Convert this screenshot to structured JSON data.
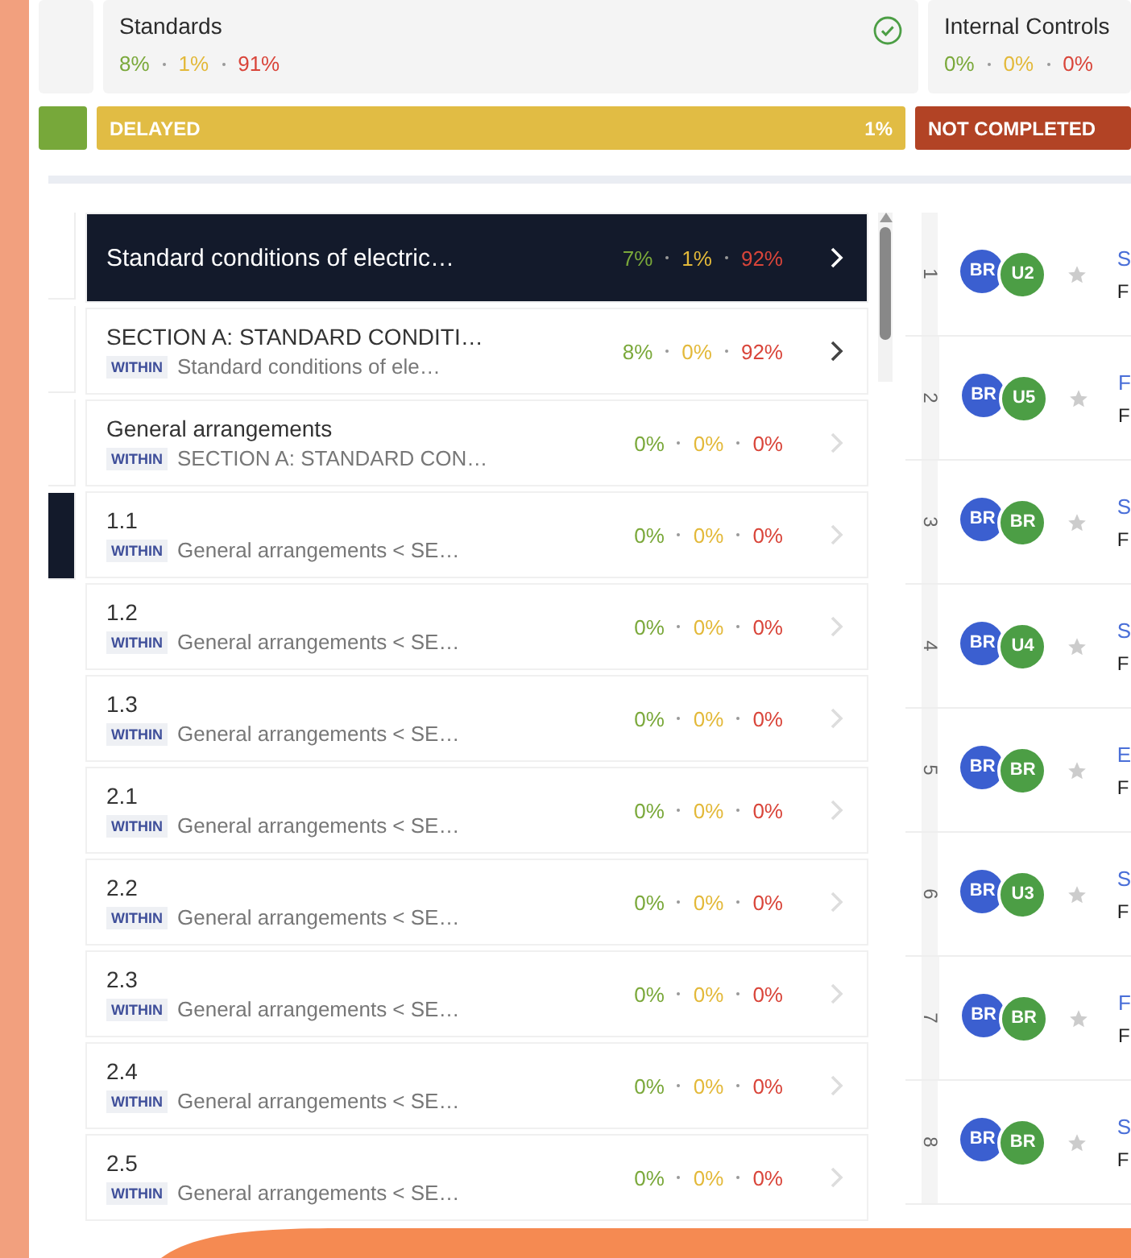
{
  "summary_cards": [
    {
      "title": "Standards",
      "checked": true,
      "stats": [
        "8%",
        "1%",
        "91%"
      ]
    },
    {
      "title": "Internal Controls",
      "checked": false,
      "stats": [
        "0%",
        "0%",
        "0%"
      ]
    }
  ],
  "status_bars": [
    {
      "kind": "completed"
    },
    {
      "kind": "delayed",
      "label": "DELAYED",
      "value": "1%"
    },
    {
      "kind": "not_completed",
      "label": "NOT COMPLETED"
    }
  ],
  "side_strip": [
    {
      "selected": false
    },
    {
      "selected": false
    },
    {
      "selected": false
    },
    {
      "selected": true
    }
  ],
  "items": [
    {
      "title": "Standard conditions of electric…",
      "selected": true,
      "has_children": true,
      "stats": [
        "7%",
        "1%",
        "92%"
      ]
    },
    {
      "title": "SECTION A: STANDARD CONDITI…",
      "within_label": "WITHIN",
      "within": "Standard conditions of ele…",
      "selected": false,
      "has_children": true,
      "stats": [
        "8%",
        "0%",
        "92%"
      ]
    },
    {
      "title": "General arrangements",
      "within_label": "WITHIN",
      "within": "SECTION A: STANDARD CON…",
      "selected": false,
      "has_children": false,
      "stats": [
        "0%",
        "0%",
        "0%"
      ]
    },
    {
      "title": "1.1",
      "within_label": "WITHIN",
      "within": "General arrangements < SE…",
      "selected": false,
      "has_children": false,
      "stats": [
        "0%",
        "0%",
        "0%"
      ]
    },
    {
      "title": "1.2",
      "within_label": "WITHIN",
      "within": "General arrangements < SE…",
      "selected": false,
      "has_children": false,
      "stats": [
        "0%",
        "0%",
        "0%"
      ]
    },
    {
      "title": "1.3",
      "within_label": "WITHIN",
      "within": "General arrangements < SE…",
      "selected": false,
      "has_children": false,
      "stats": [
        "0%",
        "0%",
        "0%"
      ]
    },
    {
      "title": "2.1",
      "within_label": "WITHIN",
      "within": "General arrangements < SE…",
      "selected": false,
      "has_children": false,
      "stats": [
        "0%",
        "0%",
        "0%"
      ]
    },
    {
      "title": "2.2",
      "within_label": "WITHIN",
      "within": "General arrangements < SE…",
      "selected": false,
      "has_children": false,
      "stats": [
        "0%",
        "0%",
        "0%"
      ]
    },
    {
      "title": "2.3",
      "within_label": "WITHIN",
      "within": "General arrangements < SE…",
      "selected": false,
      "has_children": false,
      "stats": [
        "0%",
        "0%",
        "0%"
      ]
    },
    {
      "title": "2.4",
      "within_label": "WITHIN",
      "within": "General arrangements < SE…",
      "selected": false,
      "has_children": false,
      "stats": [
        "0%",
        "0%",
        "0%"
      ]
    },
    {
      "title": "2.5",
      "within_label": "WITHIN",
      "within": "General arrangements < SE…",
      "selected": false,
      "has_children": false,
      "stats": [
        "0%",
        "0%",
        "0%"
      ]
    }
  ],
  "assignments": [
    {
      "number": "1",
      "avatars": [
        {
          "initials": "BR",
          "color": "#3b5fd0"
        },
        {
          "initials": "U2",
          "color": "#4c9e45"
        }
      ],
      "title": "S",
      "subtitle": "F"
    },
    {
      "number": "2",
      "avatars": [
        {
          "initials": "BR",
          "color": "#3b5fd0"
        },
        {
          "initials": "U5",
          "color": "#4c9e45"
        }
      ],
      "title": "F",
      "subtitle": "F"
    },
    {
      "number": "3",
      "avatars": [
        {
          "initials": "BR",
          "color": "#3b5fd0"
        },
        {
          "initials": "BR",
          "color": "#4c9e45"
        }
      ],
      "title": "S",
      "subtitle": "F"
    },
    {
      "number": "4",
      "avatars": [
        {
          "initials": "BR",
          "color": "#3b5fd0"
        },
        {
          "initials": "U4",
          "color": "#4c9e45"
        }
      ],
      "title": "S",
      "subtitle": "F"
    },
    {
      "number": "5",
      "avatars": [
        {
          "initials": "BR",
          "color": "#3b5fd0"
        },
        {
          "initials": "BR",
          "color": "#4c9e45"
        }
      ],
      "title": "E",
      "subtitle": "F"
    },
    {
      "number": "6",
      "avatars": [
        {
          "initials": "BR",
          "color": "#3b5fd0"
        },
        {
          "initials": "U3",
          "color": "#4c9e45"
        }
      ],
      "title": "S",
      "subtitle": "F"
    },
    {
      "number": "7",
      "avatars": [
        {
          "initials": "BR",
          "color": "#3b5fd0"
        },
        {
          "initials": "BR",
          "color": "#4c9e45"
        }
      ],
      "title": "F",
      "subtitle": "F"
    },
    {
      "number": "8",
      "avatars": [
        {
          "initials": "BR",
          "color": "#3b5fd0"
        },
        {
          "initials": "BR",
          "color": "#4c9e45"
        }
      ],
      "title": "S",
      "subtitle": "F"
    }
  ]
}
